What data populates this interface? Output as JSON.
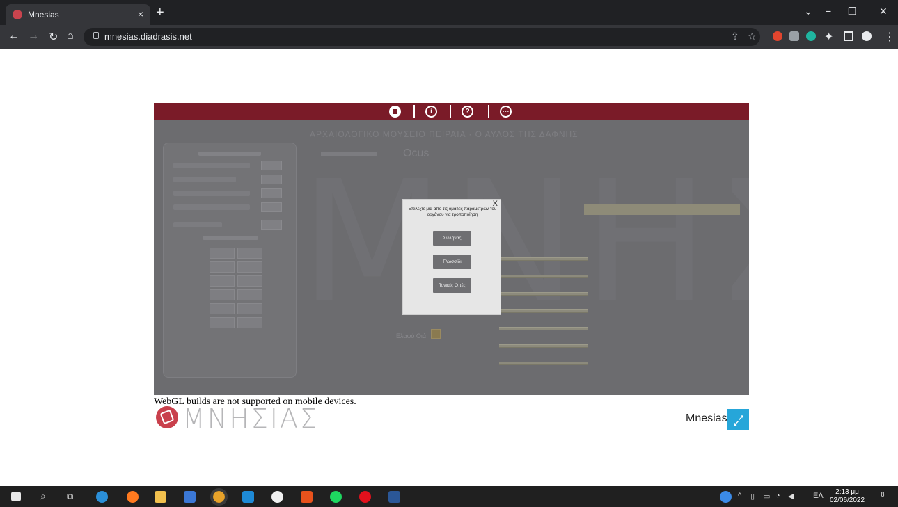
{
  "browser": {
    "tab_title": "Mnesias",
    "tab_close": "×",
    "new_tab": "+",
    "url": "mnesias.diadrasis.net",
    "window_controls": {
      "dropdown": "⌄",
      "minimize": "−",
      "restore": "❐",
      "close": "✕"
    }
  },
  "app": {
    "topbar_icons": [
      "home-icon",
      "info-icon",
      "help-icon",
      "more-icon"
    ],
    "topbar_glyphs": {
      "info": "i",
      "help": "?",
      "more": "⋯"
    },
    "background_heading": "ΑΡΧΑΙΟΛΟΓΙΚΟ ΜΟΥΣΕΙΟ ΠΕΙΡΑΙΑ · Ο ΑΥΛΟΣ ΤΗΣ ΔΑΦΝΗΣ",
    "background_word": "ΜΝΗΣΙΑΣ",
    "background_ocus": "Ocus",
    "background_knob_label": "Ελαφό Οιά",
    "modal": {
      "close": "X",
      "title": "Επιλέξτε μια από τις ομάδες παραμέτρων του οργάνου για τροποποίηση",
      "buttons": [
        "Σωλήνας",
        "Γλωσσίδι",
        "Τονικές Οπές"
      ]
    }
  },
  "page": {
    "webgl_note": "WebGL builds are not supported on mobile devices.",
    "logo_text": "ΜΝΗΣΙΑΣ",
    "footer_title": "Mnesias",
    "fullscreen_icon": "fullscreen-icon"
  },
  "taskbar": {
    "language": "ΕΛ",
    "time": "2:13 μμ",
    "date": "02/06/2022",
    "notifications": "8"
  },
  "colors": {
    "brand_red": "#7a1b28",
    "accent_blue": "#26a6d9",
    "modal_bg": "#e6e6e6",
    "modal_button": "#6f6f72"
  }
}
